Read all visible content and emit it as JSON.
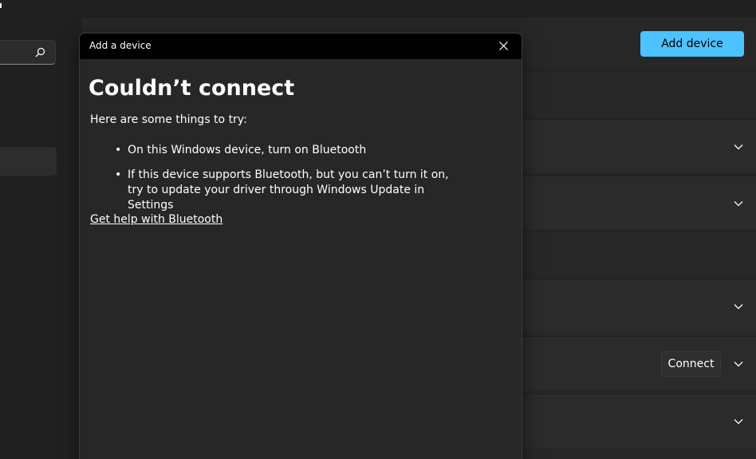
{
  "header": {
    "add_device_label": "Add device"
  },
  "devices": {
    "connect_label": "Connect"
  },
  "dialog": {
    "title": "Add a device",
    "heading": "Couldn’t connect",
    "intro": "Here are some things to try:",
    "tips": [
      "On this Windows device, turn on Bluetooth",
      "If this device supports Bluetooth, but you can’t turn it on, try to update your driver through Windows Update in Settings"
    ],
    "help_link": "Get help with Bluetooth"
  },
  "icons": {
    "search": "search-icon",
    "close": "close-icon",
    "chevron": "chevron-down-icon"
  },
  "colors": {
    "accent": "#4cc2ff",
    "background": "#202020",
    "titlebar": "#000000"
  }
}
